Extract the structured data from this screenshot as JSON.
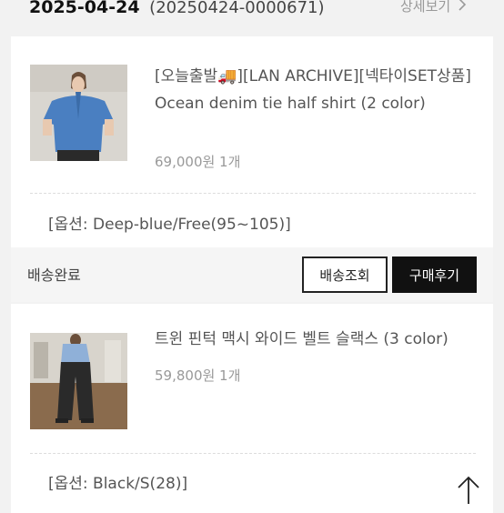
{
  "order": {
    "date": "2025-04-24",
    "number": "(20250424-0000671)",
    "detail_label": "상세보기",
    "detail_chevron": ">"
  },
  "items": [
    {
      "name": "[오늘출발🚚][LAN ARCHIVE][넥타이SET상품] Ocean denim tie half shirt (2 color)",
      "price_qty": "69,000원 1개",
      "option": "[옵션: Deep-blue/Free(95~105)]",
      "status": "배송완료",
      "track_button": "배송조회",
      "review_button": "구매후기"
    },
    {
      "name": "트윈 핀턱 맥시 와이드 벨트 슬랙스 (3 color)",
      "price_qty": "59,800원 1개",
      "option": "[옵션: Black/S(28)]"
    }
  ],
  "icons": {
    "scroll_top": "arrow-up-icon",
    "detail": "chevron-right-icon"
  },
  "colors": {
    "background": "#f2f2f2",
    "card": "#ffffff",
    "primary_button": "#111111",
    "muted_text": "#999999"
  }
}
